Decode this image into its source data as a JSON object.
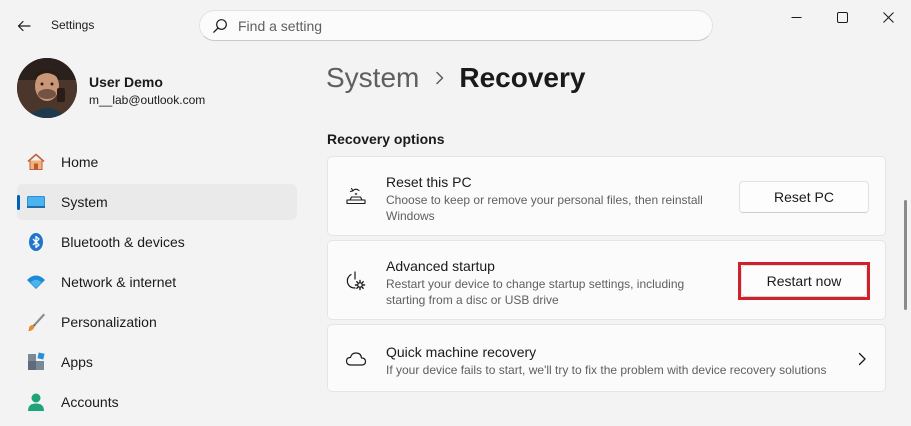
{
  "window": {
    "app_title": "Settings"
  },
  "search": {
    "placeholder": "Find a setting",
    "value": ""
  },
  "user": {
    "name": "User Demo",
    "email": "m__lab@outlook.com"
  },
  "sidebar": {
    "items": [
      {
        "label": "Home",
        "icon": "home-icon",
        "active": false
      },
      {
        "label": "System",
        "icon": "system-icon",
        "active": true
      },
      {
        "label": "Bluetooth & devices",
        "icon": "bluetooth-icon",
        "active": false
      },
      {
        "label": "Network & internet",
        "icon": "wifi-icon",
        "active": false
      },
      {
        "label": "Personalization",
        "icon": "brush-icon",
        "active": false
      },
      {
        "label": "Apps",
        "icon": "apps-icon",
        "active": false
      },
      {
        "label": "Accounts",
        "icon": "account-icon",
        "active": false
      }
    ]
  },
  "breadcrumb": {
    "parent": "System",
    "current": "Recovery"
  },
  "main": {
    "section_title": "Recovery options",
    "cards": [
      {
        "title": "Reset this PC",
        "description_line1": "Choose to keep or remove your personal files, then reinstall",
        "description_line2": "Windows",
        "button_label": "Reset PC",
        "icon": "reset-pc-icon"
      },
      {
        "title": "Advanced startup",
        "description_line1": "Restart your device to change startup settings, including",
        "description_line2": "starting from a disc or USB drive",
        "button_label": "Restart now",
        "icon": "advanced-startup-icon",
        "highlighted": true
      },
      {
        "title": "Quick machine recovery",
        "description_line1": "If your device fails to start, we'll try to fix the problem with device recovery solutions",
        "icon": "cloud-icon"
      }
    ]
  },
  "colors": {
    "accent": "#005fb8",
    "highlight_border": "#d0202a",
    "background": "#f3f3f3",
    "card": "#fbfbfb"
  }
}
